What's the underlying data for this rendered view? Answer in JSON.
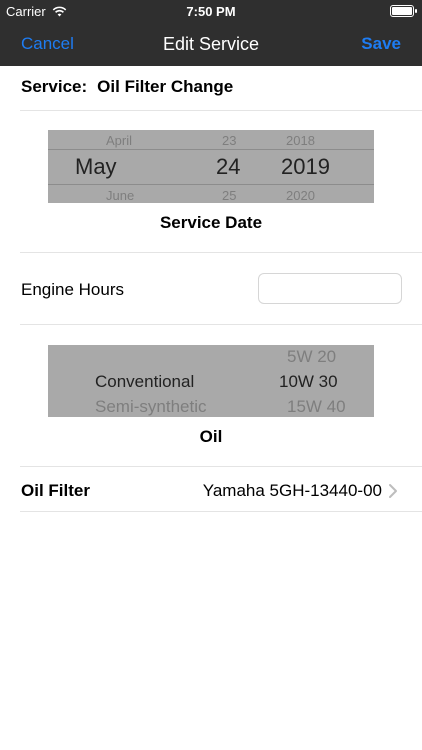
{
  "status_bar": {
    "carrier": "Carrier",
    "time": "7:50 PM"
  },
  "nav": {
    "cancel": "Cancel",
    "title": "Edit Service",
    "save": "Save",
    "accent_color": "#1e7cf2"
  },
  "service": {
    "label": "Service:",
    "name": "Oil Filter Change"
  },
  "date_picker": {
    "above": {
      "month": "April",
      "day": "23",
      "year": "2018"
    },
    "selected": {
      "month": "May",
      "day": "24",
      "year": "2019"
    },
    "below": {
      "month": "June",
      "day": "25",
      "year": "2020"
    },
    "caption": "Service Date"
  },
  "engine_hours": {
    "label": "Engine Hours",
    "value": ""
  },
  "oil_picker": {
    "above": {
      "type": "",
      "viscosity": "5W 20"
    },
    "selected": {
      "type": "Conventional",
      "viscosity": "10W 30"
    },
    "below": {
      "type": "Semi-synthetic",
      "viscosity": "15W 40"
    },
    "caption": "Oil"
  },
  "oil_filter": {
    "label": "Oil Filter",
    "value": "Yamaha 5GH-13440-00",
    "icon": "chevron-right-icon"
  }
}
